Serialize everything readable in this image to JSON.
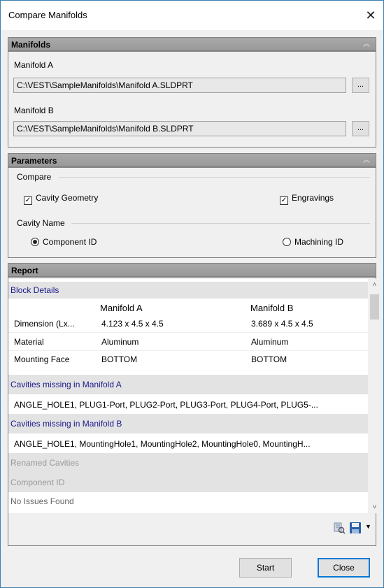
{
  "window": {
    "title": "Compare Manifolds",
    "close_glyph": "✕"
  },
  "manifolds": {
    "header": "Manifolds",
    "a_label": "Manifold A",
    "a_path": "C:\\VEST\\SampleManifolds\\Manifold A.SLDPRT",
    "b_label": "Manifold B",
    "b_path": "C:\\VEST\\SampleManifolds\\Manifold B.SLDPRT",
    "browse_label": "..."
  },
  "parameters": {
    "header": "Parameters",
    "compare_group": "Compare",
    "cavity_geometry": "Cavity Geometry",
    "engravings": "Engravings",
    "cavity_name_group": "Cavity Name",
    "component_id": "Component ID",
    "machining_id": "Machining ID",
    "cavity_geometry_checked": true,
    "engravings_checked": true,
    "selected_cavity_name": "Component ID"
  },
  "report": {
    "header": "Report",
    "block_details": "Block Details",
    "columns": [
      "",
      "Manifold A",
      "Manifold B"
    ],
    "rows": [
      {
        "label": "Dimension (Lx...",
        "a": "4.123 x 4.5 x 4.5",
        "b": "3.689 x 4.5 x 4.5"
      },
      {
        "label": "Material",
        "a": "Aluminum",
        "b": "Aluminum"
      },
      {
        "label": "Mounting Face",
        "a": "BOTTOM",
        "b": "BOTTOM"
      }
    ],
    "missing_a_title": "Cavities missing in Manifold A",
    "missing_a_list": "ANGLE_HOLE1, PLUG1-Port, PLUG2-Port, PLUG3-Port, PLUG4-Port, PLUG5-...",
    "missing_b_title": "Cavities missing in Manifold B",
    "missing_b_list": "ANGLE_HOLE1, MountingHole1, MountingHole2, MountingHole0, MountingH...",
    "renamed_title": "Renamed Cavities",
    "component_id_title": "Component ID",
    "no_issues": "No Issues Found"
  },
  "buttons": {
    "start": "Start",
    "close": "Close"
  },
  "icons": [
    "export-report-icon",
    "save-icon",
    "dropdown-arrow-icon"
  ]
}
